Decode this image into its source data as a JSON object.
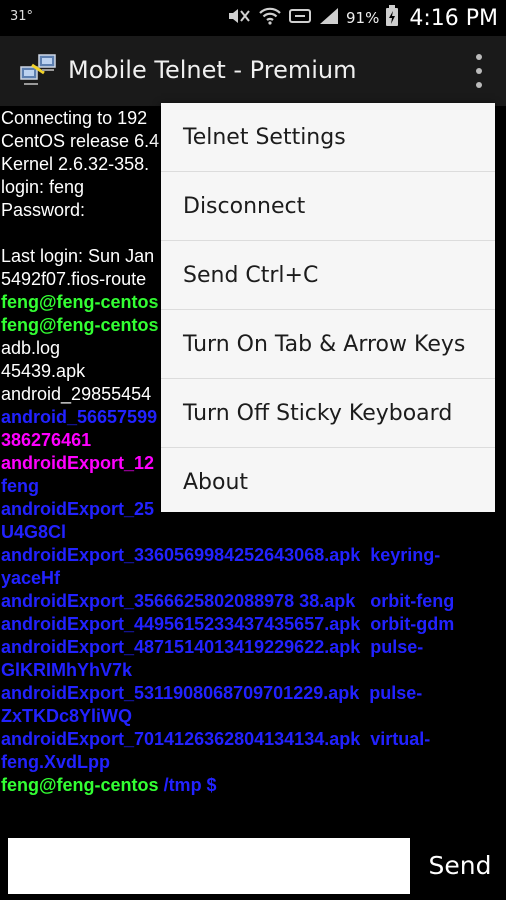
{
  "status_bar": {
    "temperature": "31°",
    "battery_percent": "91%",
    "time": "4:16 PM",
    "icons": [
      "mute-icon",
      "wifi-icon",
      "nfc-icon",
      "signal-icon",
      "battery-icon"
    ]
  },
  "action_bar": {
    "title": "Mobile Telnet - Premium",
    "app_icon": "network-computers-icon",
    "overflow_icon": "overflow-menu-icon"
  },
  "terminal": {
    "lines": [
      {
        "text": "Connecting to 192",
        "color": "white"
      },
      {
        "text": "CentOS release 6.4",
        "color": "white"
      },
      {
        "text": "Kernel 2.6.32-358.",
        "color": "white"
      },
      {
        "text": "login: feng",
        "color": "white"
      },
      {
        "text": "Password:",
        "color": "white"
      },
      {
        "text": "",
        "color": "white"
      },
      {
        "text": "Last login: Sun Jan",
        "color": "white"
      },
      {
        "text": "5492f07.fios-route",
        "color": "white"
      },
      {
        "text": "feng@feng-centos",
        "color": "green"
      },
      {
        "text": "feng@feng-centos",
        "color": "green"
      },
      {
        "text": "adb.log",
        "color": "white"
      },
      {
        "text": "45439.apk",
        "color": "white"
      },
      {
        "text": "android_29855454",
        "color": "white"
      },
      {
        "text": "android_56657599",
        "color": "blue"
      },
      {
        "text": "386276461",
        "color": "magenta"
      },
      {
        "text": "androidExport_12",
        "color": "magenta"
      },
      {
        "text": "feng",
        "color": "blue"
      },
      {
        "text": "androidExport_25",
        "color": "blue"
      },
      {
        "text": "U4G8Cl",
        "color": "blue"
      },
      {
        "text": "androidExport_3360569984252643068.apk  keyring-",
        "color": "blue"
      },
      {
        "text": "yaceHf",
        "color": "blue"
      },
      {
        "text": "androidExport_3566625802088978 38.apk   orbit-feng",
        "color": "blue"
      },
      {
        "text": "androidExport_4495615233437435657.apk  orbit-gdm",
        "color": "blue"
      },
      {
        "text": "androidExport_4871514013419229622.apk  pulse-",
        "color": "blue"
      },
      {
        "text": "GlKRIMhYhV7k",
        "color": "blue"
      },
      {
        "text": "androidExport_5311908068709701229.apk  pulse-",
        "color": "blue"
      },
      {
        "text": "ZxTKDc8YliWQ",
        "color": "blue"
      },
      {
        "text": "androidExport_7014126362804134134.apk  virtual-",
        "color": "blue"
      },
      {
        "text": "feng.XvdLpp",
        "color": "blue"
      }
    ],
    "prompt_user": "feng@feng-centos",
    "prompt_path": " /tmp $"
  },
  "input": {
    "value": "",
    "placeholder": ""
  },
  "send_label": "Send",
  "menu": {
    "items": [
      "Telnet Settings",
      "Disconnect",
      "Send Ctrl+C",
      "Turn On Tab & Arrow Keys",
      "Turn Off Sticky Keyboard",
      "About"
    ]
  },
  "colors": {
    "terminal_background": "#000000",
    "text_white": "#ffffff",
    "text_green": "#33ff33",
    "text_blue": "#2222ff",
    "text_magenta": "#ff00ff",
    "menu_background": "#f6f6f6",
    "action_bar_background": "#1a1a1a"
  }
}
